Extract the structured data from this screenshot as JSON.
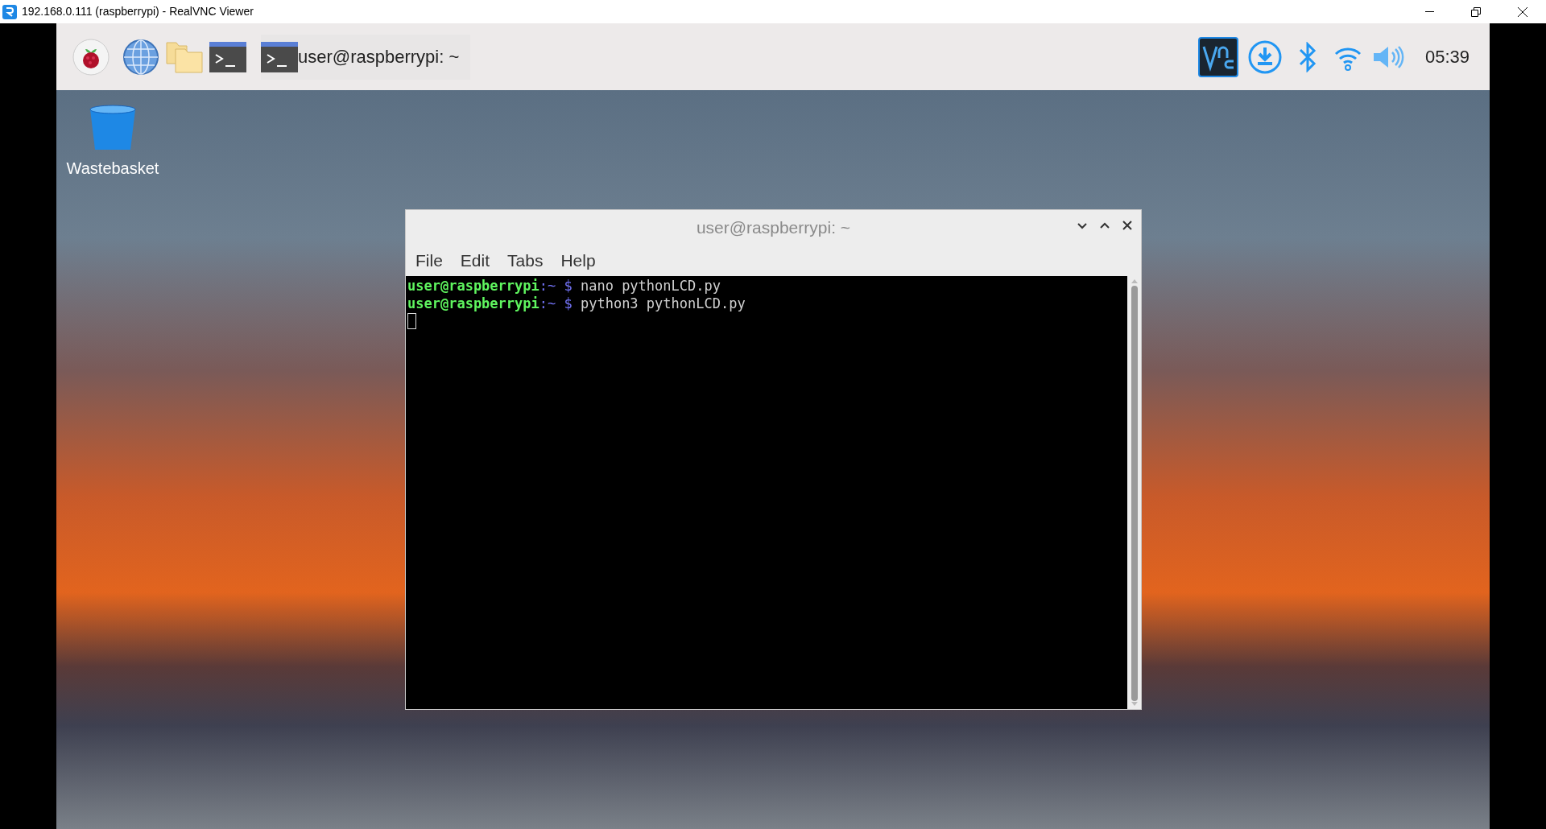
{
  "viewer_window": {
    "title": "192.168.0.111 (raspberrypi) - RealVNC Viewer"
  },
  "taskbar": {
    "task_button": {
      "label": "user@raspberrypi: ~"
    },
    "clock": "05:39"
  },
  "desktop_icons": [
    {
      "label": "Wastebasket"
    }
  ],
  "terminal": {
    "title": "user@raspberrypi: ~",
    "menu": [
      "File",
      "Edit",
      "Tabs",
      "Help"
    ],
    "lines": [
      {
        "user_host": "user@raspberrypi",
        "path": ":~",
        "symbol": "$",
        "command": "nano pythonLCD.py"
      },
      {
        "user_host": "user@raspberrypi",
        "path": ":~",
        "symbol": "$",
        "command": "python3 pythonLCD.py"
      }
    ]
  }
}
